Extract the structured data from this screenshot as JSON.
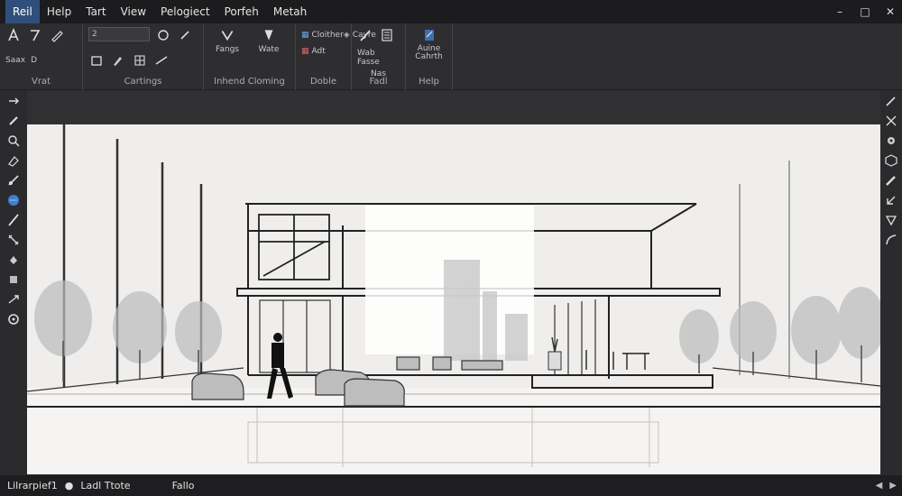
{
  "menu": {
    "items": [
      {
        "id": "reil",
        "label": "Reil"
      },
      {
        "id": "help",
        "label": "Help"
      },
      {
        "id": "tart",
        "label": "Tart"
      },
      {
        "id": "view",
        "label": "View"
      },
      {
        "id": "pelogiect",
        "label": "Pelogiect"
      },
      {
        "id": "porfeh",
        "label": "Porfeh"
      },
      {
        "id": "metah",
        "label": "Metah"
      }
    ],
    "win_controls": {
      "minimize": "–",
      "maximize": "□",
      "close": "✕"
    }
  },
  "ribbon": {
    "groups": [
      {
        "id": "vrat",
        "label": "Vrat",
        "tool_labels": [
          "Saax",
          "D"
        ]
      },
      {
        "id": "cartings",
        "label": "Cartings",
        "field_value": "2"
      },
      {
        "id": "inhend",
        "label": "Inhend Cloming",
        "tool_labels": [
          "Fangs",
          "Wate"
        ]
      },
      {
        "id": "doble",
        "label": "Doble",
        "items": [
          "Cloither",
          "Adt",
          "Cayre"
        ]
      },
      {
        "id": "fadl",
        "label": "Fadl",
        "tool_labels": [
          "Wab Fasse",
          "Nas"
        ]
      },
      {
        "id": "help-group",
        "label": "Help",
        "tool_labels": [
          "Auine",
          "Cahrth"
        ]
      }
    ]
  },
  "status": {
    "item1": "Lilrarpief1",
    "item2": "Ladl Ttote",
    "item3": "Fallo"
  },
  "colors": {
    "menubar": "#1c1c1e",
    "ribbon": "#2e2e31",
    "canvas": "#efeeec",
    "accent": "#2f4f7a"
  }
}
